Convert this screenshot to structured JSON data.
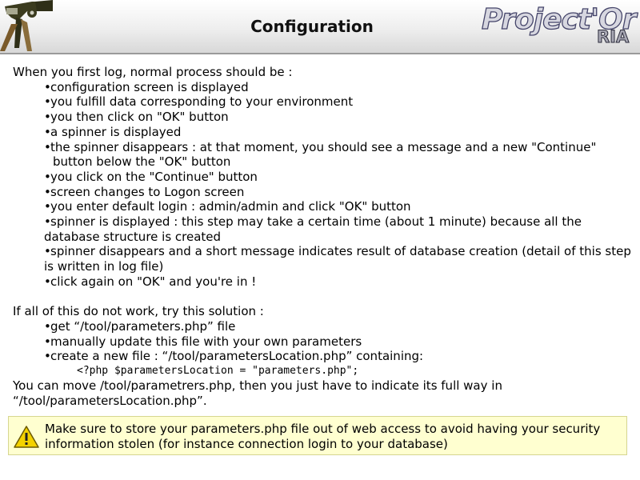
{
  "header": {
    "title": "Configuration",
    "logo_main": "Project'Or",
    "logo_sub": "RIA"
  },
  "intro": "When you first log, normal process should be :",
  "steps": [
    "configuration screen is displayed",
    "you fulfill data corresponding to your environment",
    "you then click on \"OK\" button",
    "a spinner is displayed",
    "the spinner disappears : at that moment, you should see a message and a new \"Continue\" button below the \"OK\" button",
    "you click on the \"Continue\" button",
    "screen changes to Logon screen",
    "you enter default login : admin/admin and click \"OK\" button",
    "spinner is displayed : this step may take a certain time (about 1 minute) because all the database structure is created",
    "spinner disappears and a short message indicates result of database creation (detail of this step is written in log file)",
    "click again on \"OK\" and you're in !"
  ],
  "fallback_intro": "If all of this do not work, try this solution :",
  "fallback_steps": [
    "get “/tool/parameters.php” file",
    "manually update this file with your own parameters",
    "create a new file : “/tool/parametersLocation.php” containing:"
  ],
  "code_line": "<?php $parametersLocation = \"parameters.php\";",
  "move_text_1": "You can move /tool/parametrers.php, then you just have to indicate its full way in",
  "move_text_2": "“/tool/parametersLocation.php”.",
  "note": {
    "icon": "warning-icon",
    "text": "Make sure to store your parameters.php file out of web access to avoid having your security information stolen (for instance connection login to your database)"
  }
}
